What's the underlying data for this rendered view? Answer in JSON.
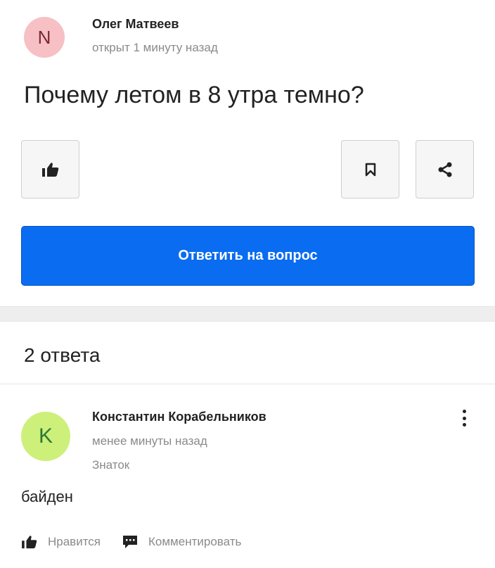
{
  "question": {
    "author_initial": "N",
    "author_name": "Олег Матвеев",
    "meta": "открыт 1 минуту назад",
    "title": "Почему летом в 8 утра темно?",
    "answer_button_label": "Ответить на вопрос"
  },
  "icons": {
    "like": "thumbs-up-icon",
    "bookmark": "bookmark-icon",
    "share": "share-icon",
    "more": "more-vertical-icon",
    "comment": "comment-icon"
  },
  "colors": {
    "accent": "#0a6cf0",
    "avatar_n_bg": "#f7c0c4",
    "avatar_k_bg": "#cdf07a"
  },
  "answers": {
    "count_label": "2 ответа",
    "items": [
      {
        "author_initial": "K",
        "author_name": "Константин Корабельников",
        "time": "менее минуты назад",
        "rank": "Знаток",
        "text": "байден",
        "like_label": "Нравится",
        "comment_label": "Комментировать"
      }
    ]
  }
}
